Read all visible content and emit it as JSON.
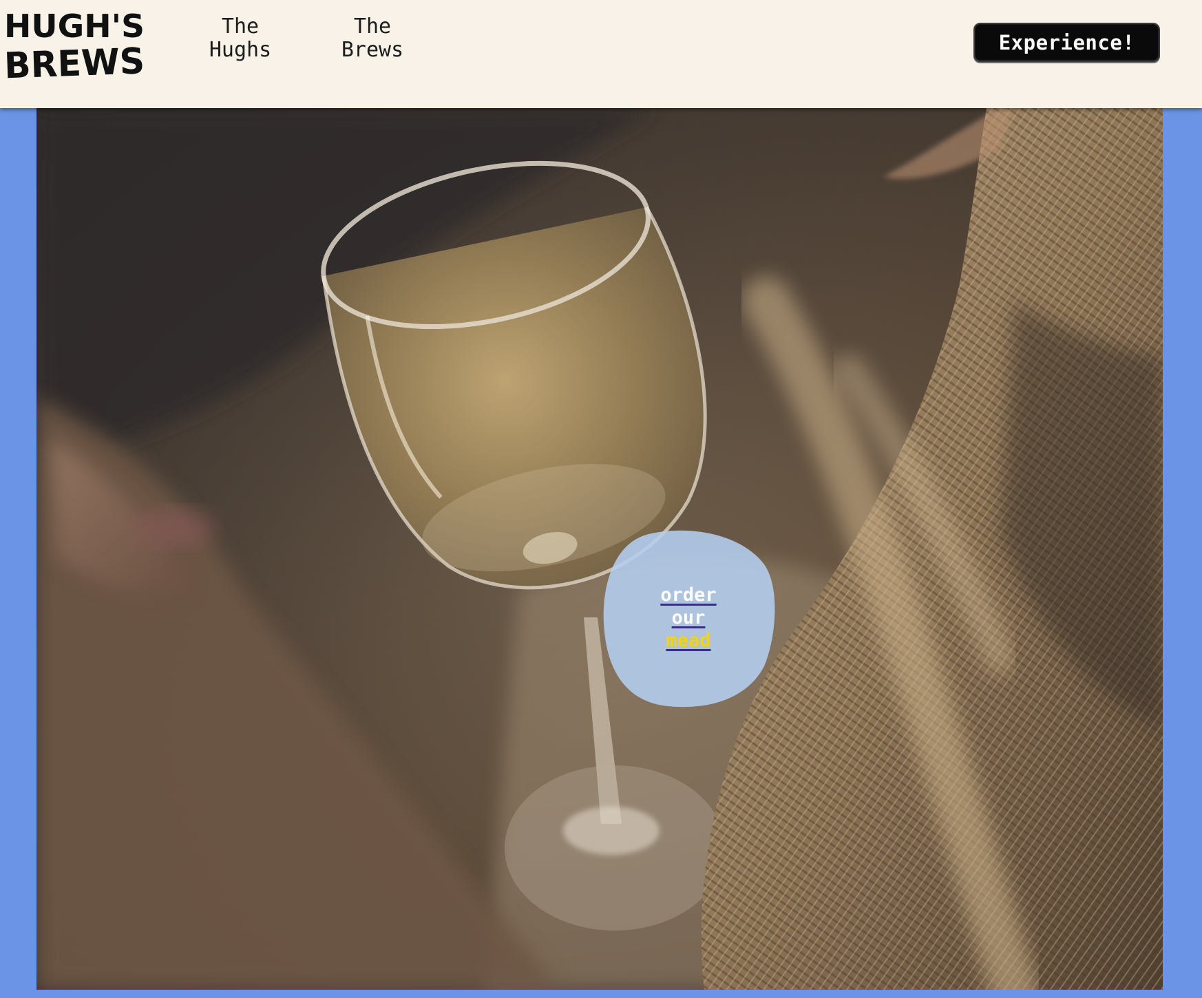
{
  "header": {
    "logo": {
      "line1": "HUGH'S",
      "line2": "BREWS"
    },
    "nav": [
      {
        "label": "The Hughs"
      },
      {
        "label": "The Brews"
      }
    ],
    "cta_label": "Experience!"
  },
  "hero": {
    "order_cta": {
      "word1": "order",
      "word2": "our",
      "word3": "mead"
    }
  },
  "colors": {
    "page_background": "#6b93e6",
    "header_background": "#f8f2e8",
    "cta_background": "#0a0a0a",
    "blob_fill": "#b4cef0",
    "highlight_text": "#f2d21a",
    "underline": "#3b2a8a"
  }
}
